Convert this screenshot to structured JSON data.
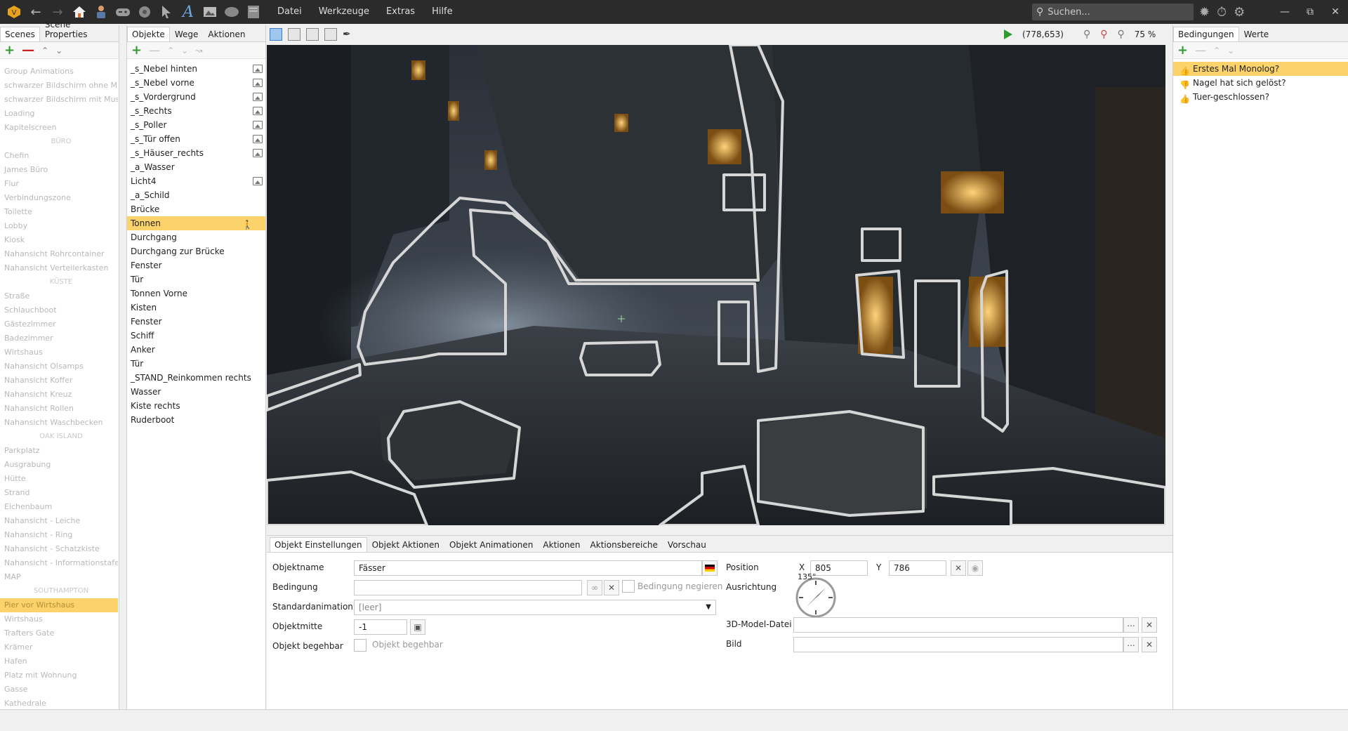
{
  "menu": {
    "items": [
      "Datei",
      "Werkzeuge",
      "Extras",
      "Hilfe"
    ]
  },
  "search": {
    "placeholder": "Suchen..."
  },
  "left_tabs": [
    "Scenes",
    "Scene Properties"
  ],
  "scenes": [
    {
      "label": "Group Animations",
      "type": "item"
    },
    {
      "label": "schwarzer Bildschirm ohne M",
      "type": "item"
    },
    {
      "label": "schwarzer Bildschirm mit Mus",
      "type": "item"
    },
    {
      "label": "Loading",
      "type": "item"
    },
    {
      "label": "Kapitelscreen",
      "type": "item"
    },
    {
      "label": "BÜRO",
      "type": "sep"
    },
    {
      "label": "Chefin",
      "type": "item"
    },
    {
      "label": "James Büro",
      "type": "item"
    },
    {
      "label": "Flur",
      "type": "item"
    },
    {
      "label": "Verbindungszone",
      "type": "item"
    },
    {
      "label": "Toilette",
      "type": "item"
    },
    {
      "label": "Lobby",
      "type": "item"
    },
    {
      "label": "Kiosk",
      "type": "item"
    },
    {
      "label": "Nahansicht Rohrcontainer",
      "type": "item"
    },
    {
      "label": "Nahansicht Verteilerkasten",
      "type": "item"
    },
    {
      "label": "KÜSTE",
      "type": "sep"
    },
    {
      "label": "Straße",
      "type": "item"
    },
    {
      "label": "Schlauchboot",
      "type": "item"
    },
    {
      "label": "Gästezimmer",
      "type": "item"
    },
    {
      "label": "Badezimmer",
      "type": "item"
    },
    {
      "label": "Wirtshaus",
      "type": "item"
    },
    {
      "label": "Nahansicht Olsamps",
      "type": "item"
    },
    {
      "label": "Nahansicht Koffer",
      "type": "item"
    },
    {
      "label": "Nahansicht Kreuz",
      "type": "item"
    },
    {
      "label": "Nahansicht Rollen",
      "type": "item"
    },
    {
      "label": "Nahansicht Waschbecken",
      "type": "item"
    },
    {
      "label": "OAK ISLAND",
      "type": "sep"
    },
    {
      "label": "Parkplatz",
      "type": "item"
    },
    {
      "label": "Ausgrabung",
      "type": "item"
    },
    {
      "label": "Hütte",
      "type": "item"
    },
    {
      "label": "Strand",
      "type": "item"
    },
    {
      "label": "Eichenbaum",
      "type": "item"
    },
    {
      "label": "Nahansicht - Leiche",
      "type": "item"
    },
    {
      "label": "Nahansicht - Ring",
      "type": "item"
    },
    {
      "label": "Nahansicht - Schatzkiste",
      "type": "item"
    },
    {
      "label": "Nahansicht - Informationstafel",
      "type": "item"
    },
    {
      "label": "MAP",
      "type": "item"
    },
    {
      "label": "SOUTHAMPTON",
      "type": "sep"
    },
    {
      "label": "Pier vor Wirtshaus",
      "type": "sel"
    },
    {
      "label": "Wirtshaus",
      "type": "item"
    },
    {
      "label": "Trafters Gate",
      "type": "item"
    },
    {
      "label": "Krämer",
      "type": "item"
    },
    {
      "label": "Hafen",
      "type": "item"
    },
    {
      "label": "Platz mit Wohnung",
      "type": "item"
    },
    {
      "label": "Gasse",
      "type": "item"
    },
    {
      "label": "Kathedrale",
      "type": "item"
    }
  ],
  "object_tabs": [
    "Objekte",
    "Wege",
    "Aktionen"
  ],
  "objects": [
    {
      "label": "_s_Nebel hinten",
      "img": true
    },
    {
      "label": "_s_Nebel vorne",
      "img": true
    },
    {
      "label": "_s_Vordergrund",
      "img": true
    },
    {
      "label": "_s_Rechts",
      "img": true
    },
    {
      "label": "_s_Poller",
      "img": true
    },
    {
      "label": "_s_Tür offen",
      "img": true
    },
    {
      "label": "_s_Häuser_rechts",
      "img": true
    },
    {
      "label": "_a_Wasser",
      "img": false
    },
    {
      "label": "Licht4",
      "img": true
    },
    {
      "label": "_a_Schild",
      "img": false
    },
    {
      "label": "Brücke",
      "img": false
    },
    {
      "label": "Tonnen",
      "img": false,
      "selected": true
    },
    {
      "label": "Durchgang",
      "img": false
    },
    {
      "label": "Durchgang zur Brücke",
      "img": false
    },
    {
      "label": "Fenster",
      "img": false
    },
    {
      "label": "Tür",
      "img": false
    },
    {
      "label": "Tonnen Vorne",
      "img": false
    },
    {
      "label": "Kisten",
      "img": false
    },
    {
      "label": "Fenster",
      "img": false
    },
    {
      "label": "Schiff",
      "img": false
    },
    {
      "label": "Anker",
      "img": false
    },
    {
      "label": "Tür",
      "img": false
    },
    {
      "label": "_STAND_Reinkommen rechts",
      "img": false
    },
    {
      "label": "Wasser",
      "img": false
    },
    {
      "label": "Kiste rechts",
      "img": false
    },
    {
      "label": "Ruderboot",
      "img": false
    }
  ],
  "canvas": {
    "coords": "(778,653)",
    "zoom": "75 %"
  },
  "bottom_tabs": [
    "Objekt Einstellungen",
    "Objekt Aktionen",
    "Objekt Animationen",
    "Aktionen",
    "Aktionsbereiche",
    "Vorschau"
  ],
  "settings": {
    "objektname_label": "Objektname",
    "objektname_value": "Fässer",
    "bedingung_label": "Bedingung",
    "bedingung_negieren": "Bedingung negieren",
    "standardanimation_label": "Standardanimation",
    "standardanimation_value": "[leer]",
    "objektmitte_label": "Objektmitte",
    "objektmitte_value": "-1",
    "begehbar_label": "Objekt begehbar",
    "begehbar_check": "Objekt begehbar",
    "position_label": "Position",
    "x_label": "X",
    "x_value": "805",
    "y_label": "Y",
    "y_value": "786",
    "ausrichtung_label": "Ausrichtung",
    "ausrichtung_value": "135°",
    "model_label": "3D-Model-Datei",
    "bild_label": "Bild",
    "ellipsis": "..."
  },
  "right_tabs": [
    "Bedingungen",
    "Werte"
  ],
  "conditions": [
    {
      "label": "Erstes Mal Monolog?",
      "state": "true",
      "selected": true
    },
    {
      "label": "Nagel hat sich gelöst?",
      "state": "false"
    },
    {
      "label": "Tuer-geschlossen?",
      "state": "true"
    }
  ]
}
